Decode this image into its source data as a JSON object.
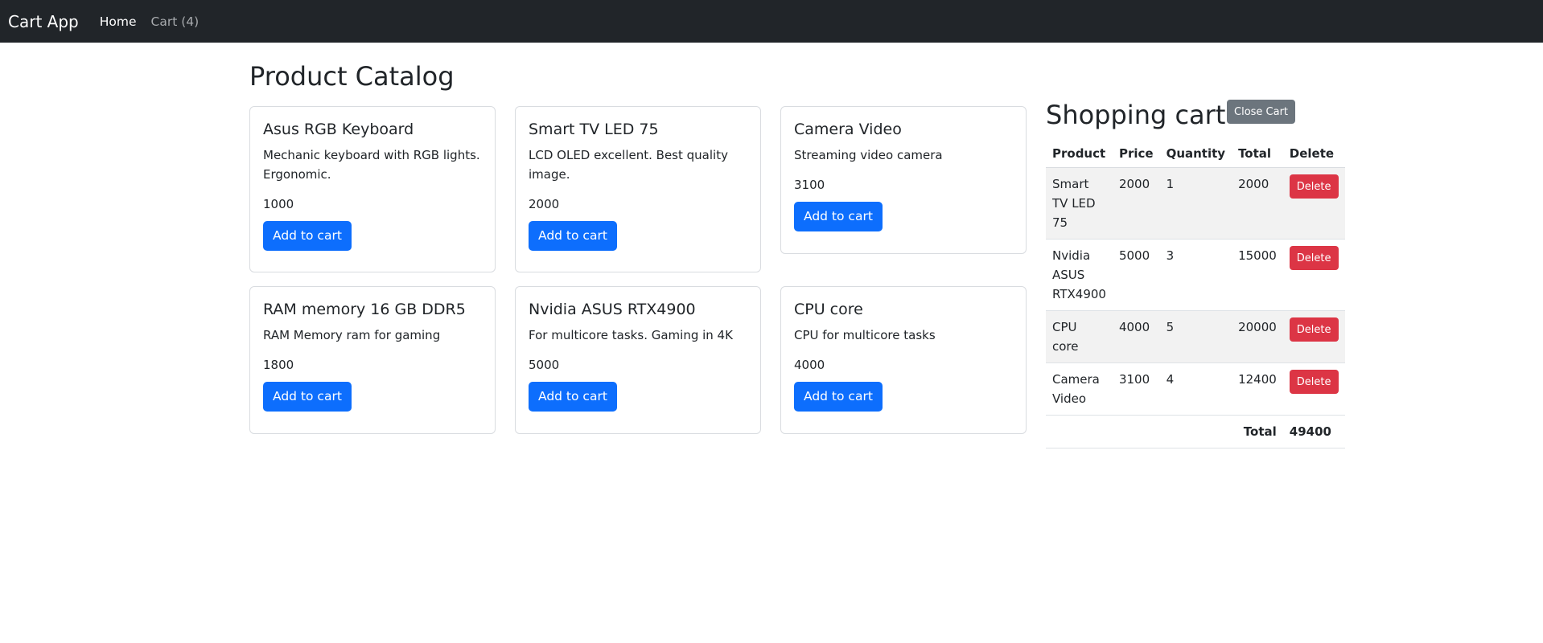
{
  "navbar": {
    "brand": "Cart App",
    "home": "Home",
    "cart": "Cart (4)"
  },
  "catalog": {
    "title": "Product Catalog",
    "add_label": "Add to cart",
    "products": [
      {
        "name": "Asus RGB Keyboard",
        "description": "Mechanic keyboard with RGB lights. Ergonomic.",
        "price": "1000"
      },
      {
        "name": "Smart TV LED 75",
        "description": "LCD OLED excellent. Best quality image.",
        "price": "2000"
      },
      {
        "name": "Camera Video",
        "description": "Streaming video camera",
        "price": "3100"
      },
      {
        "name": "RAM memory 16 GB DDR5",
        "description": "RAM Memory ram for gaming",
        "price": "1800"
      },
      {
        "name": "Nvidia ASUS RTX4900",
        "description": "For multicore tasks. Gaming in 4K",
        "price": "5000"
      },
      {
        "name": "CPU core",
        "description": "CPU for multicore tasks",
        "price": "4000"
      }
    ]
  },
  "cart": {
    "title": "Shopping cart",
    "close_label": "Close Cart",
    "headers": {
      "product": "Product",
      "price": "Price",
      "quantity": "Quantity",
      "total": "Total",
      "delete": "Delete"
    },
    "delete_label": "Delete",
    "rows": [
      {
        "product": "Smart TV LED 75",
        "price": "2000",
        "quantity": "1",
        "total": "2000"
      },
      {
        "product": "Nvidia ASUS RTX4900",
        "price": "5000",
        "quantity": "3",
        "total": "15000"
      },
      {
        "product": "CPU core",
        "price": "4000",
        "quantity": "5",
        "total": "20000"
      },
      {
        "product": "Camera Video",
        "price": "3100",
        "quantity": "4",
        "total": "12400"
      }
    ],
    "footer": {
      "label": "Total",
      "value": "49400"
    }
  },
  "colors": {
    "primary": "#0d6efd",
    "danger": "#dc3545",
    "secondary": "#6c757d",
    "navbar": "#212529"
  }
}
